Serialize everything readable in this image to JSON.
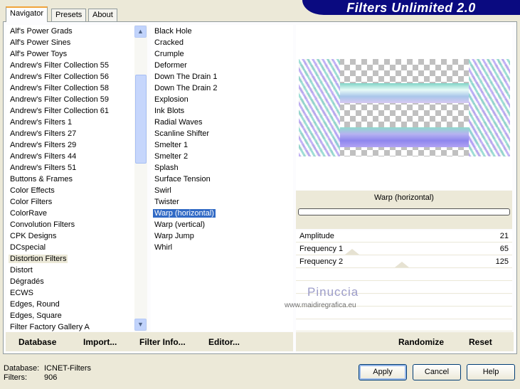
{
  "banner": "Filters Unlimited 2.0",
  "tabs": [
    {
      "label": "Navigator",
      "active": true
    },
    {
      "label": "Presets"
    },
    {
      "label": "About"
    }
  ],
  "categories": {
    "items": [
      "Alf's Power Grads",
      "Alf's Power Sines",
      "Alf's Power Toys",
      "Andrew's Filter Collection 55",
      "Andrew's Filter Collection 56",
      "Andrew's Filter Collection 58",
      "Andrew's Filter Collection 59",
      "Andrew's Filter Collection 61",
      "Andrew's Filters 1",
      "Andrew's Filters 27",
      "Andrew's Filters 29",
      "Andrew's Filters 44",
      "Andrew's Filters 51",
      "Buttons & Frames",
      "Color Effects",
      "Color Filters",
      "ColorRave",
      "Convolution Filters",
      "CPK Designs",
      "DCspecial",
      "Distortion Filters",
      "Distort",
      "Dégradés",
      "ECWS",
      "Edges, Round",
      "Edges, Square",
      "Filter Factory Gallery A"
    ],
    "selected": "Distortion Filters"
  },
  "filters": {
    "items": [
      "Black Hole",
      "Cracked",
      "Crumple",
      "Deformer",
      "Down The Drain 1",
      "Down The Drain 2",
      "Explosion",
      "Ink Blots",
      "Radial Waves",
      "Scanline Shifter",
      "Smelter 1",
      "Smelter 2",
      "Splash",
      "Surface Tension",
      "Swirl",
      "Twister",
      "Warp (horizontal)",
      "Warp (vertical)",
      "Warp Jump",
      "Whirl"
    ],
    "selected": "Warp (horizontal)"
  },
  "toolbar_left": {
    "database": "Database",
    "import": "Import...",
    "filter_info": "Filter Info...",
    "editor": "Editor..."
  },
  "filter_title": "Warp (horizontal)",
  "progress": 0,
  "params": [
    {
      "label": "Amplitude",
      "value": "21"
    },
    {
      "label": "Frequency 1",
      "value": "65"
    },
    {
      "label": "Frequency 2",
      "value": "125"
    }
  ],
  "toolbar_right": {
    "randomize": "Randomize",
    "reset": "Reset"
  },
  "watermark": {
    "name": "Pinuccia",
    "url": "www.maidiregrafica.eu"
  },
  "status": {
    "database_label": "Database:",
    "database_value": "ICNET-Filters",
    "filters_label": "Filters:",
    "filters_value": "906"
  },
  "buttons": {
    "apply": "Apply",
    "cancel": "Cancel",
    "help": "Help"
  },
  "colors": {
    "banner": "#0a0a80",
    "selection": "#316ac5",
    "tab_accent": "#f1a43a"
  }
}
